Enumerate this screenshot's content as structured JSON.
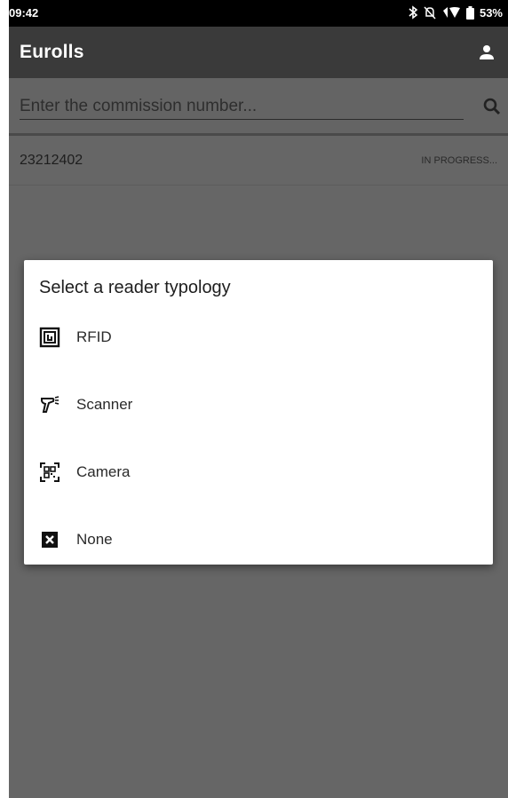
{
  "status_bar": {
    "time": "09:42",
    "battery": "53%",
    "icons": [
      "bluetooth-icon",
      "notifications-off-icon",
      "wifi-icon",
      "battery-icon"
    ]
  },
  "app_bar": {
    "title": "Eurolls",
    "account_icon": "account-icon"
  },
  "search": {
    "placeholder": "Enter the commission number...",
    "value": "",
    "icon": "search-icon"
  },
  "list": {
    "items": [
      {
        "number": "23212402",
        "status": "IN PROGRESS..."
      }
    ]
  },
  "dialog": {
    "title": "Select a reader typology",
    "options": [
      {
        "label": "RFID",
        "icon": "rfid-icon"
      },
      {
        "label": "Scanner",
        "icon": "barcode-scanner-icon"
      },
      {
        "label": "Camera",
        "icon": "qr-camera-icon"
      },
      {
        "label": "None",
        "icon": "close-box-icon"
      }
    ]
  },
  "colors": {
    "status_bar": "#000000",
    "app_bar": "#3a3a3a",
    "scrim": "#666666",
    "dialog_bg": "#ffffff"
  }
}
